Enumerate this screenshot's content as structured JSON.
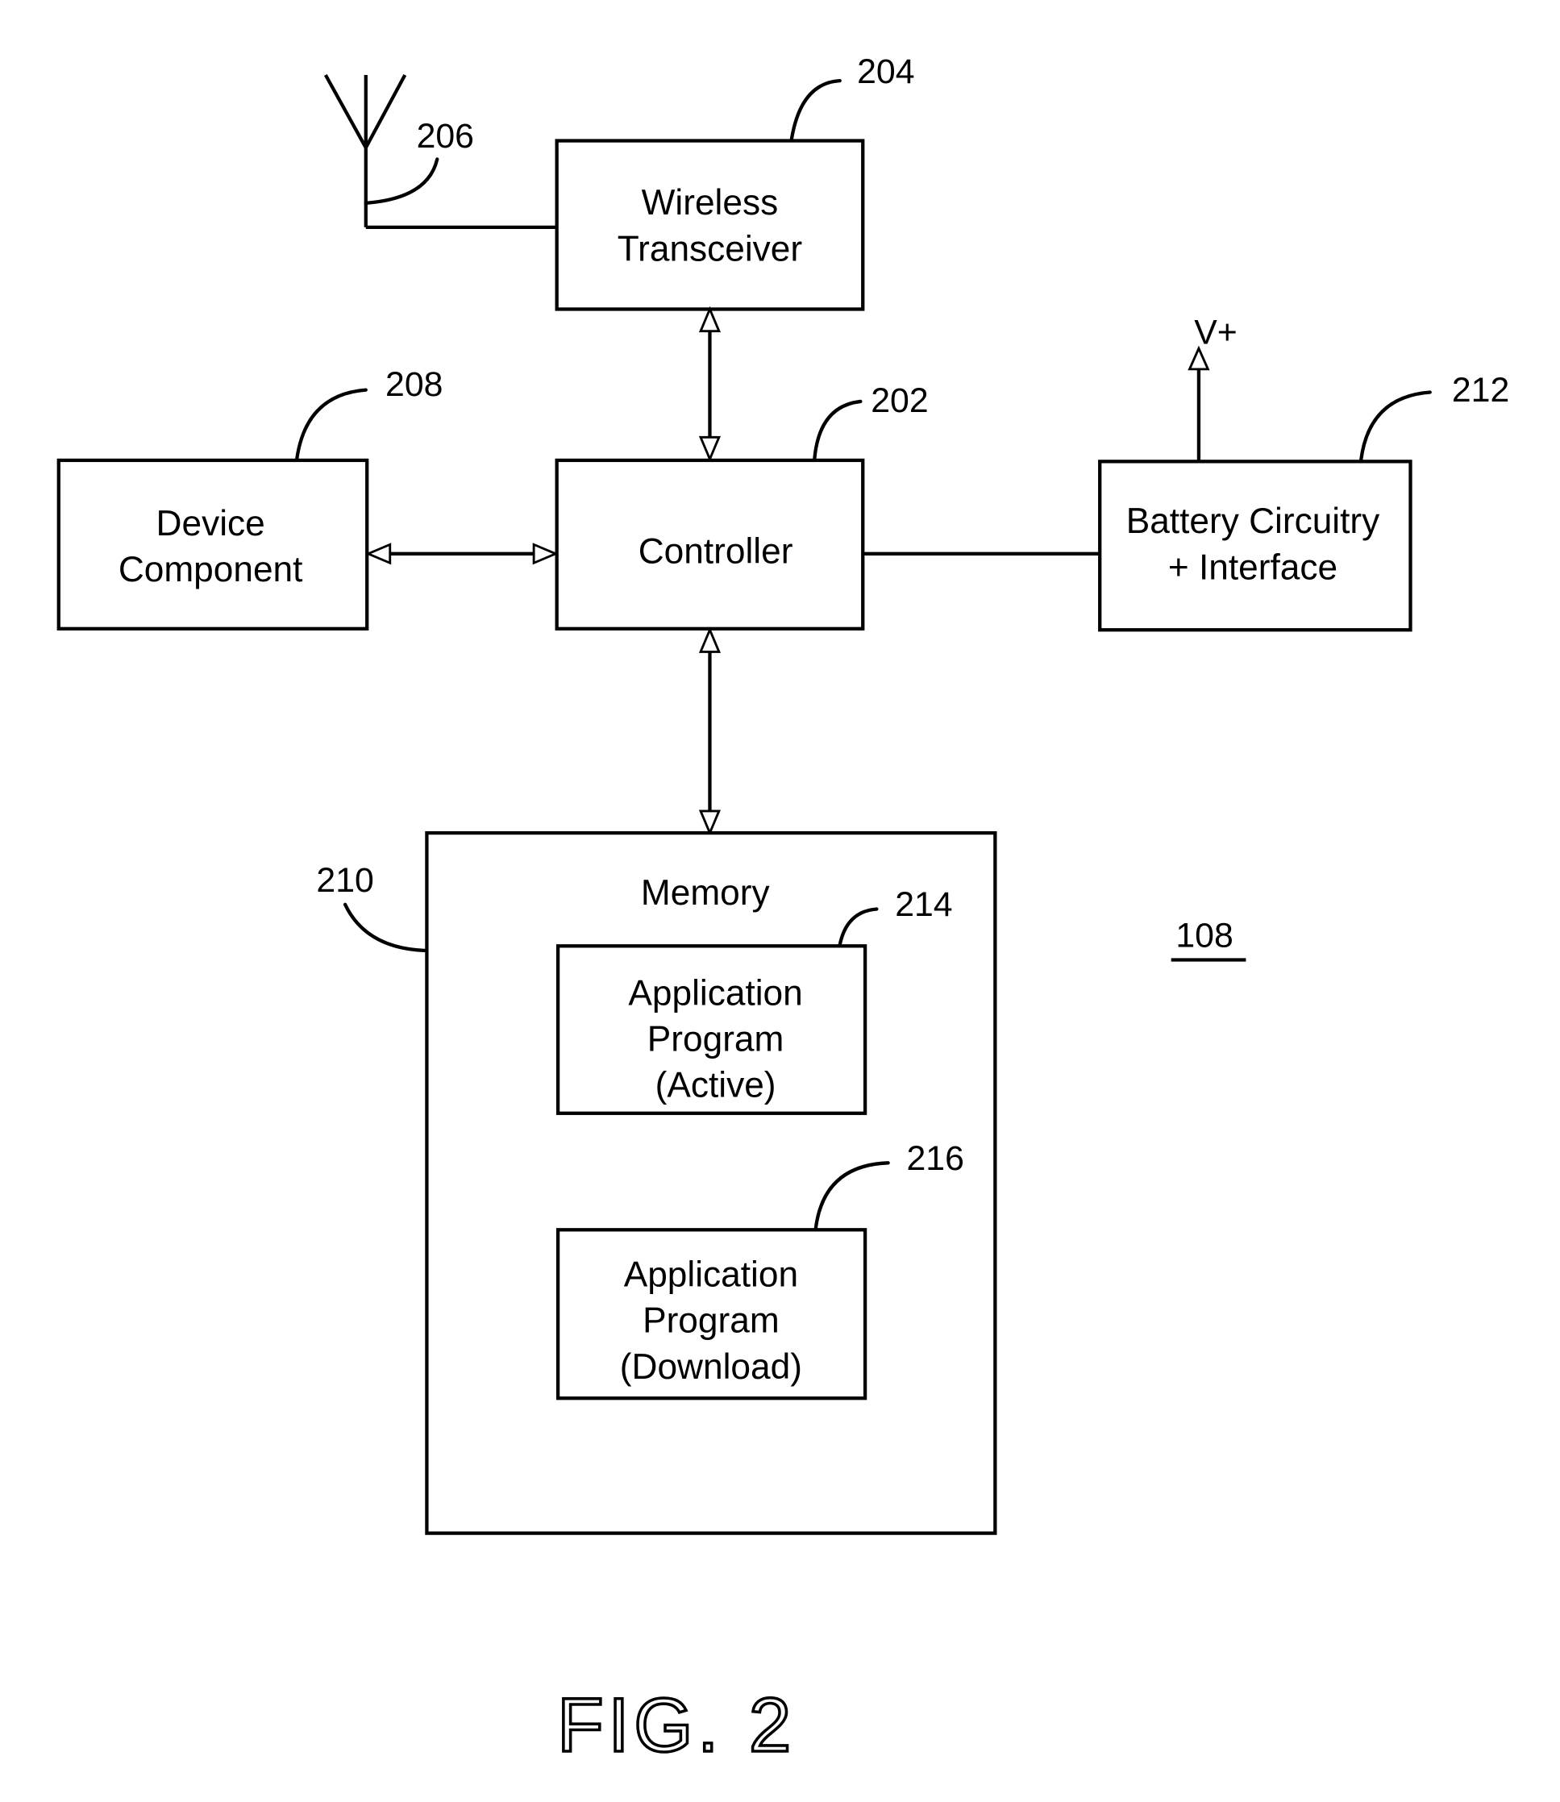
{
  "figure": {
    "title": "FIG. 2",
    "device_ref": "108"
  },
  "blocks": {
    "wireless_transceiver": {
      "lines": [
        "Wireless",
        "Transceiver"
      ],
      "ref": "204"
    },
    "antenna": {
      "ref": "206"
    },
    "controller": {
      "lines": [
        "Controller"
      ],
      "ref": "202"
    },
    "device_component": {
      "lines": [
        "Device",
        "Component"
      ],
      "ref": "208"
    },
    "battery": {
      "lines": [
        "Battery Circuitry",
        "+ Interface"
      ],
      "ref": "212",
      "output_label": "V+"
    },
    "memory": {
      "label": "Memory",
      "ref": "210"
    },
    "app_active": {
      "lines": [
        "Application",
        "Program",
        "(Active)"
      ],
      "ref": "214"
    },
    "app_download": {
      "lines": [
        "Application",
        "Program",
        "(Download)"
      ],
      "ref": "216"
    }
  },
  "connections": [
    {
      "from": "antenna",
      "to": "wireless_transceiver",
      "type": "line"
    },
    {
      "from": "wireless_transceiver",
      "to": "controller",
      "type": "bidirectional-arrow"
    },
    {
      "from": "device_component",
      "to": "controller",
      "type": "bidirectional-arrow"
    },
    {
      "from": "controller",
      "to": "battery",
      "type": "line"
    },
    {
      "from": "battery",
      "to": "V+",
      "type": "arrow"
    },
    {
      "from": "controller",
      "to": "memory",
      "type": "bidirectional-arrow"
    }
  ]
}
